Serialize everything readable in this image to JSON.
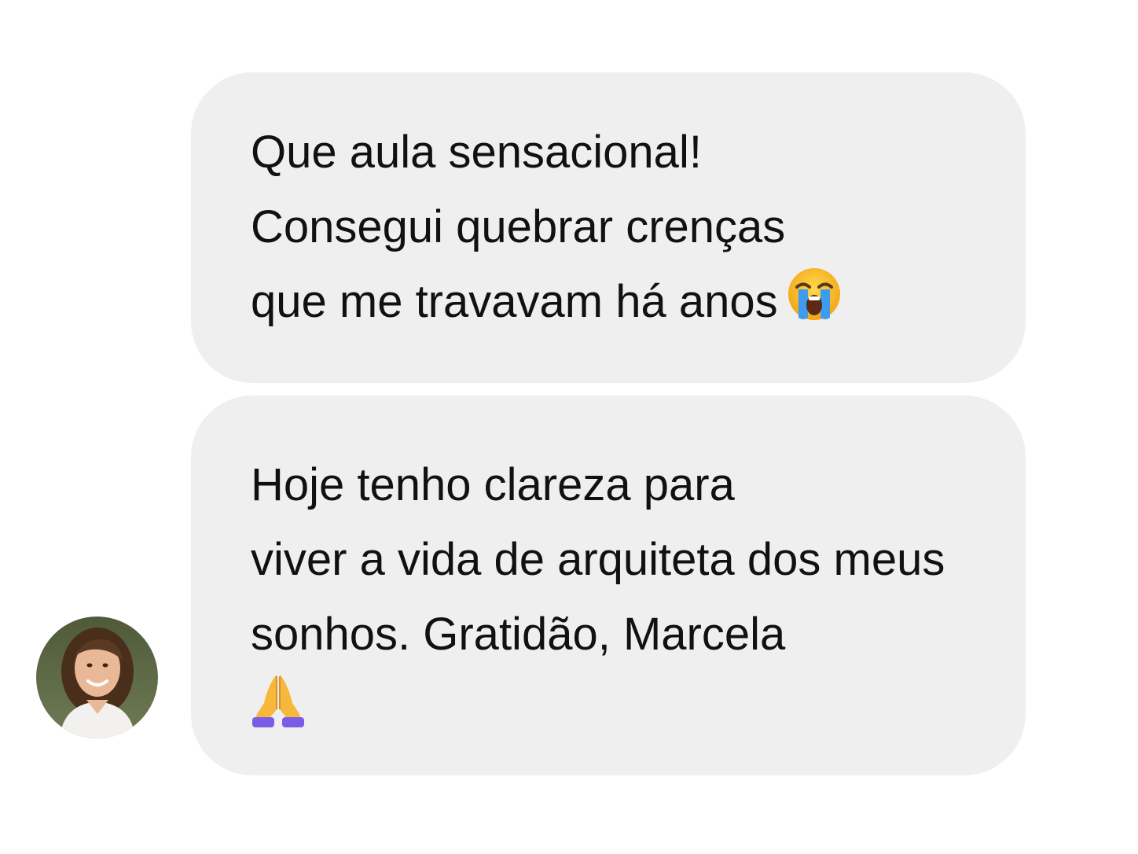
{
  "conversation": {
    "messages": [
      {
        "lines": [
          "Que aula sensacional!",
          "Consegui quebrar crenças",
          "que me travavam há anos"
        ],
        "emoji": "loudly-crying-face-icon"
      },
      {
        "lines": [
          "Hoje tenho clareza para",
          "viver a vida de arquiteta dos meus",
          "sonhos. Gratidão, Marcela"
        ],
        "emoji": "folded-hands-icon"
      }
    ],
    "avatar": "sender-avatar"
  },
  "colors": {
    "bubble": "#efefef",
    "text": "#111111",
    "background": "#ffffff"
  }
}
